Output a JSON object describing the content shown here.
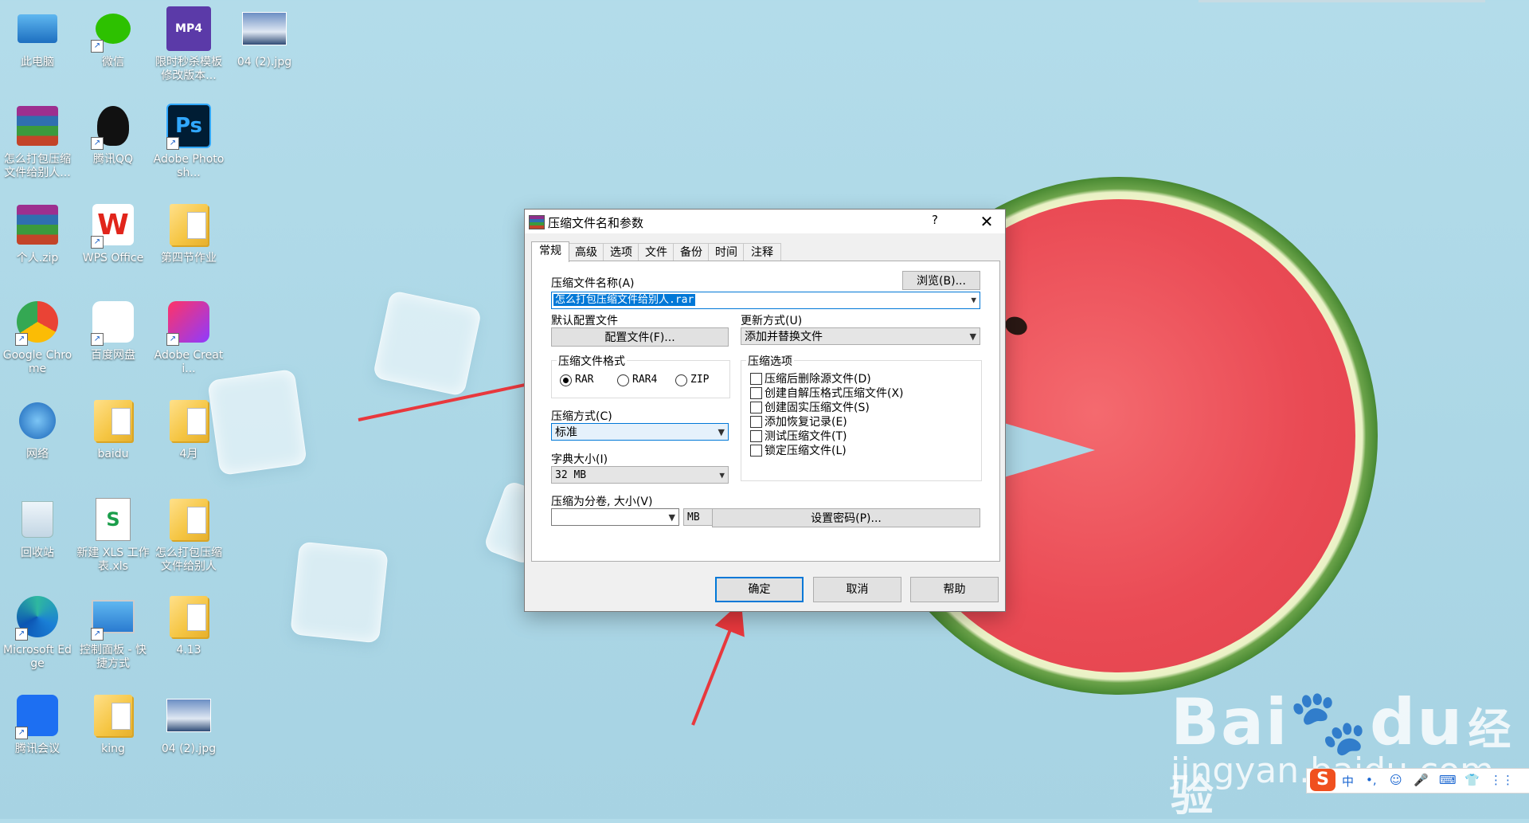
{
  "desktop": {
    "icons": [
      {
        "label": "此电脑",
        "icon": "computer-icon"
      },
      {
        "label": "微信",
        "icon": "wechat-icon"
      },
      {
        "label": "限时秒杀模板修改版本...",
        "icon": "mp4-video-icon",
        "badge": "MP4"
      },
      {
        "label": "04 (2).jpg",
        "icon": "image-icon"
      },
      {
        "label": "怎么打包压缩文件给别人...",
        "icon": "winrar-archive-icon"
      },
      {
        "label": "腾讯QQ",
        "icon": "qq-icon"
      },
      {
        "label": "Adobe Photosh...",
        "icon": "photoshop-icon",
        "badge": "Ps"
      },
      {
        "label": "个人.zip",
        "icon": "winrar-archive-icon"
      },
      {
        "label": "WPS Office",
        "icon": "wps-icon",
        "badge": "W"
      },
      {
        "label": "第四节作业",
        "icon": "folder-icon"
      },
      {
        "label": "Google Chrome",
        "icon": "chrome-icon"
      },
      {
        "label": "百度网盘",
        "icon": "baidu-netdisk-icon"
      },
      {
        "label": "Adobe Creati...",
        "icon": "creative-cloud-icon"
      },
      {
        "label": "网络",
        "icon": "network-icon"
      },
      {
        "label": "baidu",
        "icon": "folder-icon"
      },
      {
        "label": "4月",
        "icon": "folder-icon"
      },
      {
        "label": "回收站",
        "icon": "recycle-bin-icon"
      },
      {
        "label": "新建 XLS 工作表.xls",
        "icon": "xls-file-icon",
        "badge": "S"
      },
      {
        "label": "怎么打包压缩文件给别人",
        "icon": "folder-icon"
      },
      {
        "label": "Microsoft Edge",
        "icon": "edge-icon"
      },
      {
        "label": "控制面板 - 快捷方式",
        "icon": "control-panel-icon"
      },
      {
        "label": "4.13",
        "icon": "folder-icon"
      },
      {
        "label": "腾讯会议",
        "icon": "tencent-meeting-icon"
      },
      {
        "label": "king",
        "icon": "folder-icon"
      },
      {
        "label": "04 (2).jpg",
        "icon": "image-icon"
      }
    ]
  },
  "dialog": {
    "title": "压缩文件名和参数",
    "help_glyph": "?",
    "close_glyph": "✕",
    "tabs": [
      "常规",
      "高级",
      "选项",
      "文件",
      "备份",
      "时间",
      "注释"
    ],
    "active_tab": "常规",
    "archive_name_label": "压缩文件名称(A)",
    "browse_button": "浏览(B)...",
    "archive_name_value": "怎么打包压缩文件给别人.rar",
    "profile_label": "默认配置文件",
    "profile_button": "配置文件(F)...",
    "update_label": "更新方式(U)",
    "update_value": "添加并替换文件",
    "format_group": "压缩文件格式",
    "formats": [
      "RAR",
      "RAR4",
      "ZIP"
    ],
    "selected_format": "RAR",
    "method_label": "压缩方式(C)",
    "method_value": "标准",
    "dict_label": "字典大小(I)",
    "dict_value": "32 MB",
    "split_label": "压缩为分卷, 大小(V)",
    "split_value": "",
    "split_unit": "MB",
    "options_group": "压缩选项",
    "options": [
      {
        "label": "压缩后删除源文件(D)",
        "checked": false
      },
      {
        "label": "创建自解压格式压缩文件(X)",
        "checked": false
      },
      {
        "label": "创建固实压缩文件(S)",
        "checked": false
      },
      {
        "label": "添加恢复记录(E)",
        "checked": false
      },
      {
        "label": "测试压缩文件(T)",
        "checked": false
      },
      {
        "label": "锁定压缩文件(L)",
        "checked": false
      }
    ],
    "password_button": "设置密码(P)...",
    "ok_button": "确定",
    "cancel_button": "取消",
    "help_button": "帮助"
  },
  "watermark": {
    "brand": "Bai",
    "brand2": "du",
    "cn": "经验",
    "url": "jingyan.baidu.com"
  },
  "tray": {
    "ime_logo": "S",
    "items": [
      "中",
      "•,",
      "☺",
      "🎤",
      "⌨",
      "👕",
      "⋮⋮"
    ]
  },
  "colors": {
    "accent": "#0078d7",
    "arrow": "#e8383d",
    "desktop_bg": "#acd7e6"
  }
}
